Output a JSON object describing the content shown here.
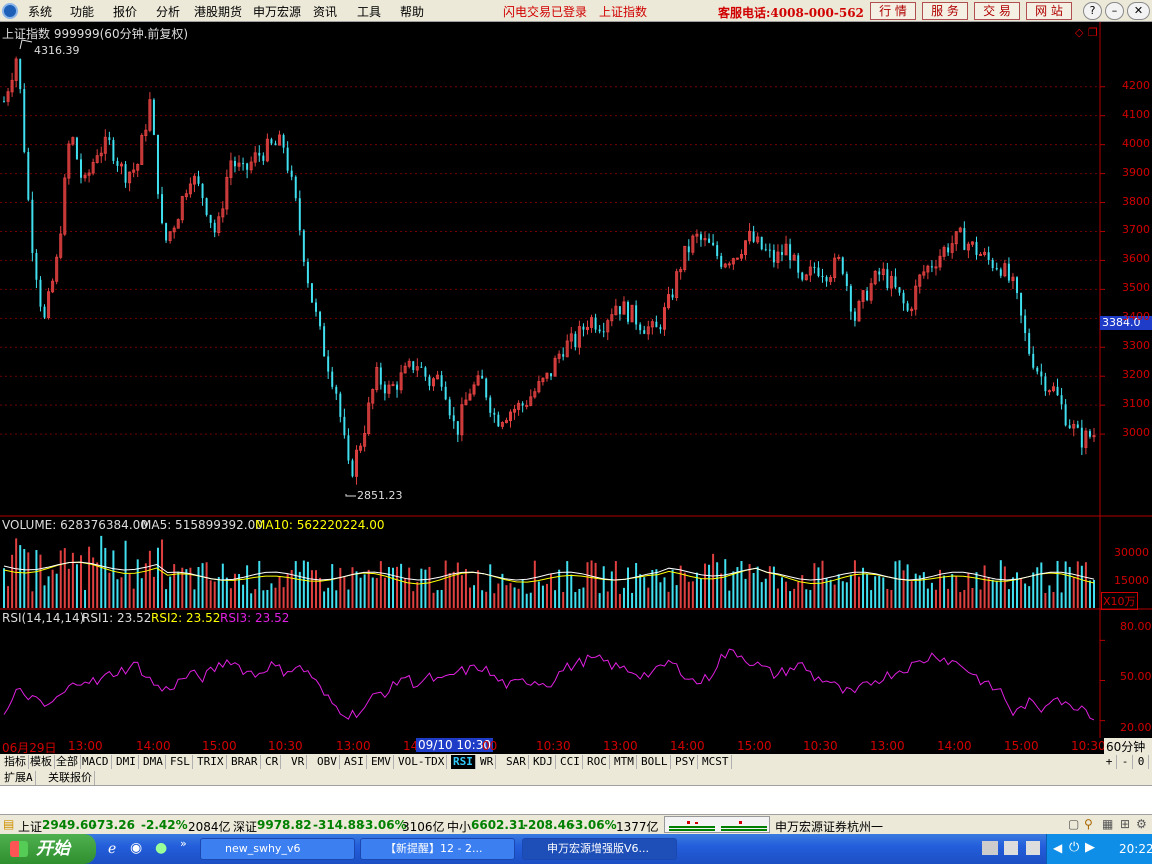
{
  "menubar": {
    "items": [
      "系统",
      "功能",
      "报价",
      "分析",
      "港股期货",
      "申万宏源",
      "资讯",
      "工具",
      "帮助"
    ],
    "flash_status": "闪电交易已登录",
    "index_link": "上证指数",
    "hotline": "客服电话:4008-000-562",
    "top_buttons": [
      "行 情",
      "服 务",
      "交 易",
      "网 站"
    ],
    "win_buttons": [
      "?",
      "–",
      "❐",
      "✕"
    ]
  },
  "chart_data": [
    {
      "type": "candlestick",
      "title": "上证指数 999999(60分钟.前复权)",
      "y_ticks": [
        3000,
        3100,
        3200,
        3300,
        3400,
        3500,
        3600,
        3700,
        3800,
        3900,
        4000,
        4100,
        4200
      ],
      "ylim": [
        2800,
        4320
      ],
      "high_label": "4316.39",
      "low_label": "2851.23",
      "current_price_label": "3384.0",
      "ohlc_approx": [
        4150,
        4316,
        3700,
        3380,
        3600,
        4050,
        3850,
        3980,
        4000,
        3900,
        3920,
        4150,
        3650,
        3750,
        3900,
        3820,
        3680,
        3950,
        3900,
        3960,
        3990,
        4005,
        3780,
        3500,
        3300,
        3150,
        2851,
        3000,
        3200,
        3150,
        3200,
        3250,
        3180,
        3200,
        3000,
        3150,
        3180,
        3050,
        3080,
        3100,
        3150,
        3200,
        3300,
        3320,
        3400,
        3380,
        3450,
        3420,
        3380,
        3350,
        3450,
        3600,
        3680,
        3650,
        3600,
        3620,
        3680,
        3640,
        3600,
        3650,
        3500,
        3580,
        3560,
        3600,
        3400,
        3500,
        3560,
        3500,
        3420,
        3550,
        3600,
        3650,
        3680,
        3640,
        3600,
        3580,
        3500,
        3300,
        3200,
        3150,
        3050,
        2980,
        3000
      ]
    },
    {
      "type": "bar",
      "title": "VOLUME",
      "volume_label": "VOLUME: 628376384.00",
      "ma5_label": "MA5: 515899392.00",
      "ma10_label": "MA10: 562220224.00",
      "y_ticks": [
        "30000",
        "15000"
      ],
      "unit": "X10万"
    },
    {
      "type": "line",
      "title": "RSI(14,14,14)",
      "rsi1_label": "RSI1: 23.52",
      "rsi2_label": "RSI2: 23.52",
      "rsi3_label": "RSI3: 23.52",
      "y_ticks": [
        "80.00",
        "50.00",
        "20.00"
      ],
      "ylim": [
        10,
        90
      ],
      "values": [
        23,
        42,
        38,
        30,
        36,
        45,
        52,
        48,
        55,
        58,
        62,
        50,
        42,
        48,
        55,
        52,
        60,
        66,
        58,
        54,
        62,
        57,
        60,
        56,
        40,
        30,
        24,
        28,
        40,
        42,
        54,
        47,
        52,
        49,
        56,
        58,
        60,
        51,
        46,
        49,
        50,
        47,
        58,
        62,
        66,
        65,
        60,
        58,
        54,
        56,
        64,
        57,
        48,
        52,
        68,
        72,
        65,
        60,
        54,
        58,
        62,
        52,
        50,
        42,
        40,
        48,
        52,
        56,
        60,
        64,
        70,
        65,
        62,
        54,
        46,
        42,
        24,
        34,
        28,
        40,
        30,
        32,
        23
      ]
    }
  ],
  "xaxis": {
    "labels": [
      "06月29日",
      "13:00",
      "14:00",
      "15:00",
      "10:30",
      "13:00",
      "14",
      "09/10 10:30",
      "00",
      "10:30",
      "13:00",
      "14:00",
      "15:00",
      "10:30",
      "13:00",
      "14:00",
      "15:00",
      "10:30"
    ],
    "period": "60分钟"
  },
  "tabs": [
    "指标",
    "模板",
    "全部",
    "MACD",
    "DMI",
    "DMA",
    "FSL",
    "TRIX",
    "BRAR",
    "CR",
    "VR",
    "OBV",
    "ASI",
    "EMV",
    "VOL-TDX",
    "RSI",
    "WR",
    "SAR",
    "KDJ",
    "CCI",
    "ROC",
    "MTM",
    "BOLL",
    "PSY",
    "MCST"
  ],
  "tab_controls": [
    "+",
    "-",
    "0"
  ],
  "tabs2": [
    "扩展A",
    "关联报价"
  ],
  "status": {
    "sh_name": "上证",
    "sh_value": "2949.60",
    "sh_change": "-73.26",
    "sh_pct": "-2.42%",
    "sh_amount": "2084亿",
    "sz_name": "深证",
    "sz_value": "9978.82",
    "sz_change": "-314.88",
    "sz_pct": "-3.06%",
    "sz_amount": "3106亿",
    "zx_name": "中小",
    "zx_value": "6602.31",
    "zx_change": "-208.46",
    "zx_pct": "-3.06%",
    "zx_amount": "1377亿",
    "broker": "申万宏源证券杭州一"
  },
  "taskbar": {
    "start": "开始",
    "tasks": [
      "new_swhy_v6",
      "【新提醒】12 - 2...",
      "申万宏源增强版V6..."
    ],
    "clock": "20:22"
  }
}
